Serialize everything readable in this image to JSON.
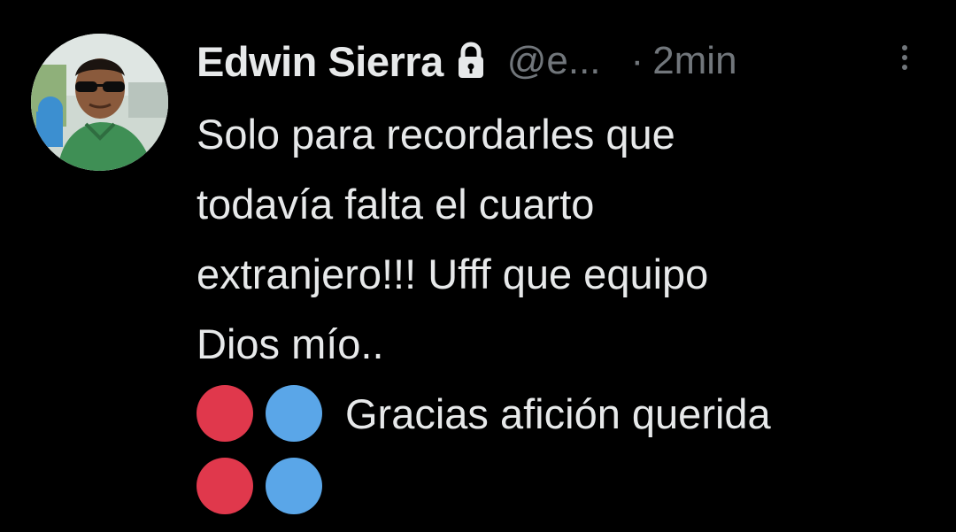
{
  "tweet": {
    "author_name": "Edwin Sierra",
    "handle": "@e...",
    "separator": "·",
    "time": "2min",
    "lines": [
      "Solo para recordarles que",
      "todavía falta el cuarto",
      "extranjero!!! Ufff que equipo",
      "Dios mío.."
    ],
    "closing_text": "Gracias afición querida"
  },
  "icons": {
    "lock": "lock-icon",
    "more": "more-vertical-icon",
    "circles": [
      "red-circle-emoji",
      "blue-circle-emoji"
    ]
  },
  "colors": {
    "background": "#000000",
    "text": "#e7e9ea",
    "muted": "#71767b",
    "red_circle": "#e0384c",
    "blue_circle": "#5aa6e8"
  }
}
